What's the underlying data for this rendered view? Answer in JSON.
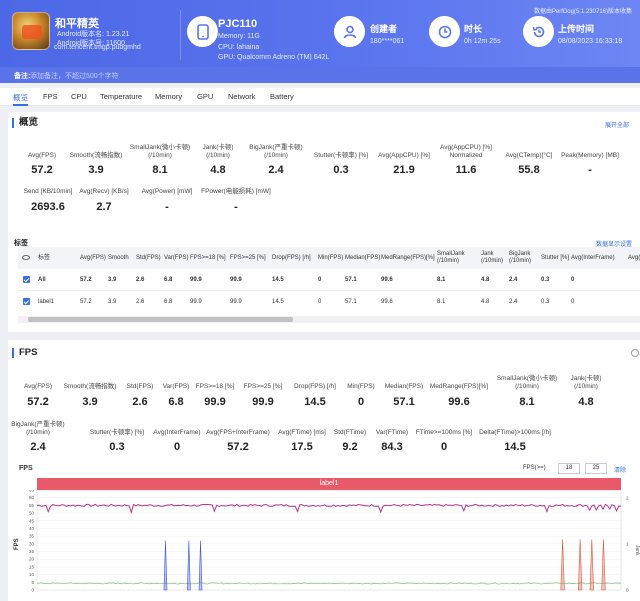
{
  "header": {
    "app_name": "和平精英",
    "android_version": "Android版本名: 1.23.21",
    "android_code": "Android版本号: 11600",
    "package": "com.tencent.tmgp.pubgmhd",
    "device_model": "PJC110",
    "memory": "Memory: 11G",
    "cpu": "CPU: lahaina",
    "gpu": "GPU: Qualcomm Adreno (TM) 642L",
    "creator_label": "创建者",
    "creator_value": "180****061",
    "duration_label": "时长",
    "duration_value": "0h 12m 25s",
    "upload_label": "上传时间",
    "upload_value": "08/08/2023 16:33:18",
    "version_line": "数据由PerfDog(5.1.230716)版本收集"
  },
  "note": {
    "label": "备注:",
    "placeholder": "添加备注，不超过500个字符"
  },
  "tabs": [
    "概览",
    "FPS",
    "CPU",
    "Temperature",
    "Memory",
    "GPU",
    "Network",
    "Battery"
  ],
  "overview": {
    "title": "概览",
    "expand_link": "展开全部",
    "metrics_row1": [
      {
        "label": "Avg(FPS)",
        "value": "57.2"
      },
      {
        "label": "Smooth(流畅指数)",
        "value": "3.9"
      },
      {
        "label": "SmallJank(微小卡顿)\n(/10min)",
        "value": "8.1"
      },
      {
        "label": "Jank(卡顿)\n(/10min)",
        "value": "4.8"
      },
      {
        "label": "BigJank(严重卡顿)\n(/10min)",
        "value": "2.4"
      },
      {
        "label": "Stutter(卡顿率) [%]",
        "value": "0.3"
      },
      {
        "label": "Avg(AppCPU) [%]",
        "value": "21.9"
      },
      {
        "label": "Avg(AppCPU) [%]\nNormalized",
        "value": "11.6"
      },
      {
        "label": "Avg(CTemp)[°C]",
        "value": "55.8"
      },
      {
        "label": "Peak(Memory) [MB]",
        "value": "-"
      }
    ],
    "metrics_row2": [
      {
        "label": "Send [KB/10min]",
        "value": "2693.6"
      },
      {
        "label": "Avg(Recv) [KB/s]",
        "value": "2.7"
      },
      {
        "label": "Avg(Power) [mW]",
        "value": "-"
      },
      {
        "label": "FPower(电能损耗) [mW]",
        "value": "-"
      }
    ]
  },
  "labels_table": {
    "title": "标签",
    "link": "数据显示设置",
    "headers": [
      "标签",
      "Avg(FPS)",
      "Smooth",
      "Std(FPS)",
      "Var(FPS)",
      "FPS>=18 [%]",
      "FPS>=25 [%]",
      "Drop(FPS) [/h]",
      "Min(FPS)",
      "Median(FPS)",
      "MedRange(FPS)[%]",
      "SmallJank\n(/10min)",
      "Jank\n(/10min)",
      "BigJank\n(/10min)",
      "Stutter [%]",
      "Avg(InterFrame)",
      "Avg(F"
    ],
    "rows": [
      {
        "label": "All",
        "values": [
          "57.2",
          "3.9",
          "2.6",
          "6.8",
          "99.9",
          "99.9",
          "14.5",
          "0",
          "57.1",
          "99.6",
          "8.1",
          "4.8",
          "2.4",
          "0.3",
          "0",
          ""
        ]
      },
      {
        "label": "label1",
        "values": [
          "57.2",
          "3.9",
          "2.6",
          "6.8",
          "99.9",
          "99.9",
          "14.5",
          "0",
          "57.1",
          "99.6",
          "8.1",
          "4.8",
          "2.4",
          "0.3",
          "0",
          ""
        ]
      }
    ]
  },
  "fps_section": {
    "title": "FPS",
    "metrics_row1": [
      {
        "label": "Avg(FPS)",
        "value": "57.2"
      },
      {
        "label": "Smooth(流畅指数)",
        "value": "3.9"
      },
      {
        "label": "Std(FPS)",
        "value": "2.6"
      },
      {
        "label": "Var(FPS)",
        "value": "6.8"
      },
      {
        "label": "FPS>=18 [%]",
        "value": "99.9"
      },
      {
        "label": "FPS>=25 [%]",
        "value": "99.9"
      },
      {
        "label": "Drop(FPS) [/h]",
        "value": "14.5"
      },
      {
        "label": "Min(FPS)",
        "value": "0"
      },
      {
        "label": "Median(FPS)",
        "value": "57.1"
      },
      {
        "label": "MedRange(FPS)[%]",
        "value": "99.6"
      },
      {
        "label": "SmallJank(微小卡顿)\n(/10min)",
        "value": "8.1"
      },
      {
        "label": "Jank(卡顿)\n(/10min)",
        "value": "4.8"
      }
    ],
    "metrics_row2": [
      {
        "label": "BigJank(严重卡顿)\n(/10min)",
        "value": "2.4"
      },
      {
        "label": "Stutter(卡顿率) [%]",
        "value": "0.3"
      },
      {
        "label": "Avg(InterFrame)",
        "value": "0"
      },
      {
        "label": "Avg(FPS+InterFrame)",
        "value": "57.2"
      },
      {
        "label": "Avg(FTime) [ms]",
        "value": "17.5"
      },
      {
        "label": "Std(FTime)",
        "value": "9.2"
      },
      {
        "label": "Var(FTime)",
        "value": "84.3"
      },
      {
        "label": "FTime>=100ms [%]",
        "value": "0"
      },
      {
        "label": "Delta(FTime)>100ms [/h]",
        "value": "14.5"
      }
    ],
    "chart_title": "FPS",
    "fps_filter_label": "FPS(>=)",
    "fps_filter_a": "18",
    "fps_filter_b": "25",
    "clear_link": "清除"
  },
  "chart_data": {
    "type": "line",
    "title": "FPS",
    "legend": [
      "label1"
    ],
    "ylabel": "FPS",
    "y2label": "Jank",
    "yticks": [
      "0",
      "5",
      "10",
      "15",
      "20",
      "25",
      "30",
      "35",
      "40",
      "45",
      "50",
      "55",
      "60",
      "65"
    ],
    "y2ticks": [
      "0",
      "1",
      "2"
    ],
    "ylim": [
      0,
      65
    ],
    "series": [
      {
        "name": "FPS",
        "color": "#b8338f",
        "level": 55
      },
      {
        "name": "Jank",
        "color": "#3a55e0",
        "spikes": [
          22,
          26,
          28
        ]
      },
      {
        "name": "BigJank",
        "color": "#e05a3a",
        "spikes": [
          90,
          93,
          95,
          97
        ]
      }
    ]
  },
  "colors": {
    "accent": "#3a6fe0",
    "header": "#5a74ee",
    "legend": "#e85a6a"
  }
}
